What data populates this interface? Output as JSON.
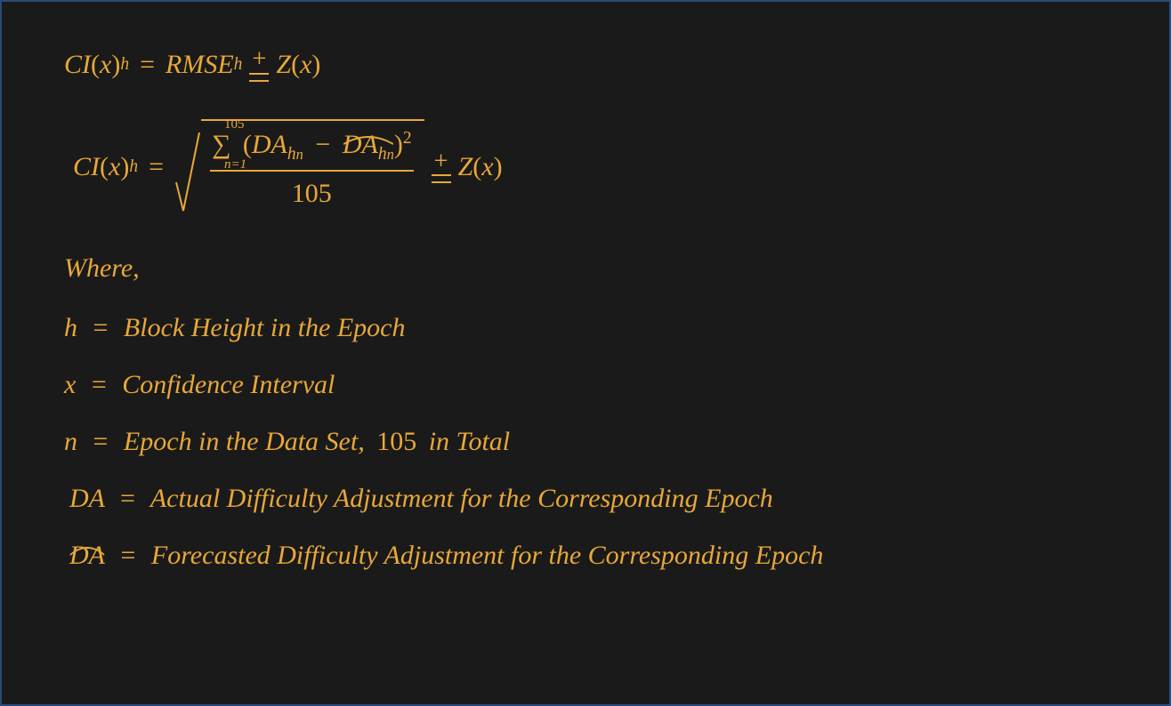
{
  "eq1": {
    "lhs_CI": "CI",
    "lhs_x": "x",
    "lhs_h": "h",
    "eq": "=",
    "rmse": "RMSE",
    "rmse_h": "h",
    "pm_plus": "+",
    "Z": "Z",
    "Z_x": "x"
  },
  "eq2": {
    "lhs_CI": "CI",
    "lhs_x": "x",
    "lhs_h": "h",
    "eq": "=",
    "sigma": "∑",
    "sigma_top": "105",
    "sigma_bot": "n=1",
    "lparen": "(",
    "DA1": "DA",
    "DA1_h": "h",
    "DA1_n": "n",
    "minus": "−",
    "DA2": "DA",
    "DA2_h": "h",
    "DA2_n": "n",
    "rparen": ")",
    "sq": "2",
    "den": "105",
    "pm_plus": "+",
    "Z": "Z",
    "Z_x": "x"
  },
  "where": "Where,",
  "defs": {
    "h_sym": "h",
    "h_eq": "=",
    "h_text": "Block Height in the Epoch",
    "x_sym": "x",
    "x_eq": "=",
    "x_text": "Confidence Interval",
    "n_sym": "n",
    "n_eq": "=",
    "n_text_a": "Epoch in the Data Set,",
    "n_num": "105",
    "n_text_b": "in Total",
    "DA_sym": "DA",
    "DA_eq": "=",
    "DA_text": "Actual Difficulty Adjustment for the Corresponding Epoch",
    "DAhat_sym": "DA",
    "DAhat_eq": "=",
    "DAhat_text": "Forecasted Difficulty Adjustment for the Corresponding Epoch"
  }
}
